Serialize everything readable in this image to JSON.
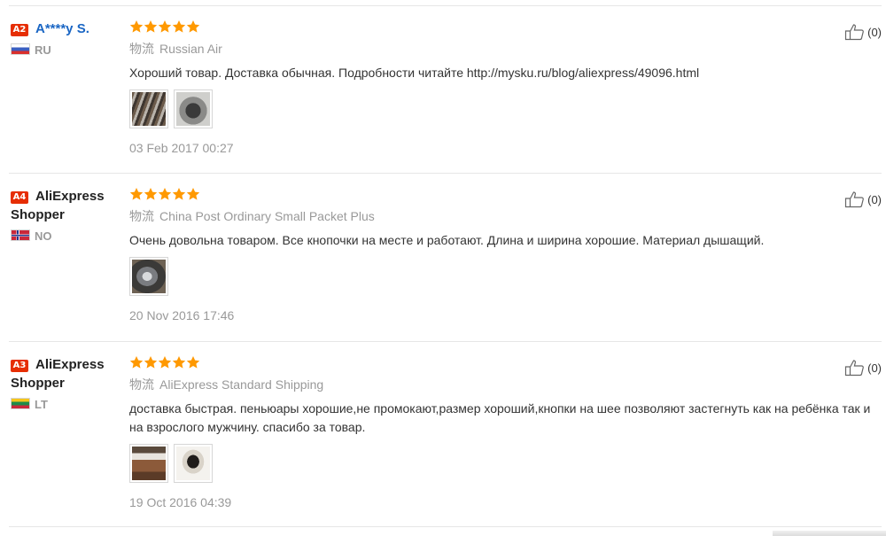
{
  "colors": {
    "star": "#ff9900",
    "badge": "#e62e04",
    "muted": "#999999",
    "link": "#1a66c4"
  },
  "reviews": [
    {
      "level": "A2",
      "name_line1": "A****y S.",
      "name_line2": "",
      "country": "RU",
      "flag": "russia-flag-icon",
      "stars": 5,
      "shipping_label": "物流",
      "shipping": "Russian Air",
      "text": "Хороший товар. Доставка обычная. Подробности читайте http://mysku.ru/blog/aliexpress/49096.html",
      "photos": 2,
      "date": "03 Feb 2017 00:27",
      "helpful_count": "(0)"
    },
    {
      "level": "A4",
      "name_line1": "AliExpress",
      "name_line2": "Shopper",
      "country": "NO",
      "flag": "norway-flag-icon",
      "stars": 5,
      "shipping_label": "物流",
      "shipping": "China Post Ordinary Small Packet Plus",
      "text": "Очень довольна товаром. Все кнопочки на месте и работают. Длина и ширина хорошие. Материал дышащий.",
      "photos": 1,
      "date": "20 Nov 2016 17:46",
      "helpful_count": "(0)"
    },
    {
      "level": "A3",
      "name_line1": "AliExpress",
      "name_line2": "Shopper",
      "country": "LT",
      "flag": "lithuania-flag-icon",
      "stars": 5,
      "shipping_label": "物流",
      "shipping": "AliExpress Standard Shipping",
      "text": "доставка быстрая. пеньюары хорошие,не промокают,размер хороший,кнопки на шее позволяют застегнуть как на ребёнка так и на взрослого мужчину. спасибо за товар.",
      "photos": 2,
      "date": "19 Oct 2016 04:39",
      "helpful_count": "(0)"
    }
  ]
}
